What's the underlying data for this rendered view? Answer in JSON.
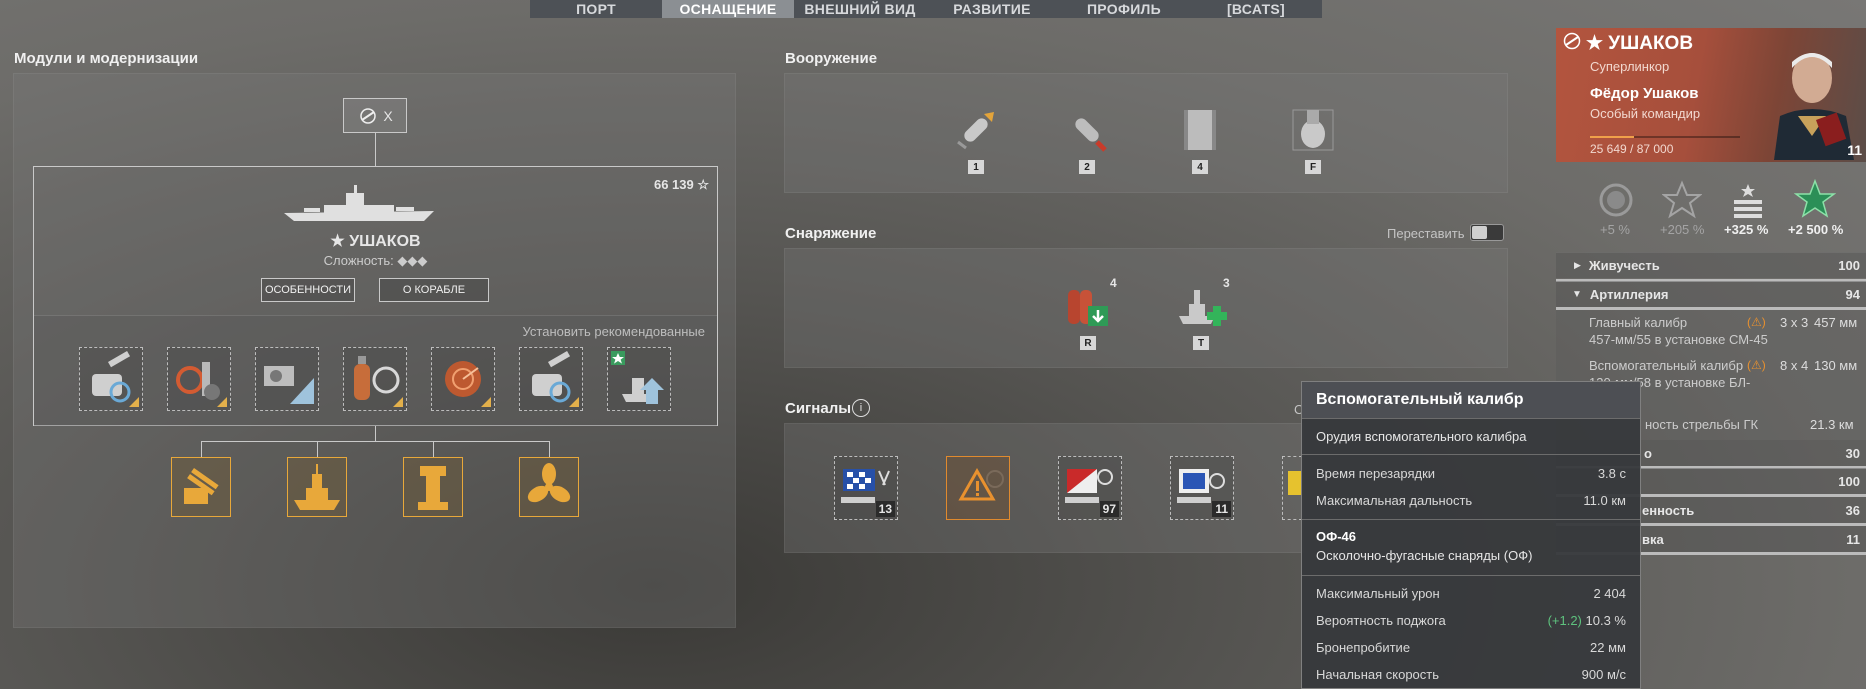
{
  "nav": {
    "tabs": [
      "ПОРТ",
      "ОСНАЩЕНИЕ",
      "ВНЕШНИЙ ВИД",
      "РАЗВИТИЕ",
      "ПРОФИЛЬ",
      "[ВСАТS]"
    ],
    "active_index": 1
  },
  "modules": {
    "title": "Модули и модернизации",
    "tier": "X",
    "ship_name": "★ УШАКОВ",
    "xp": "66 139 ☆",
    "difficulty_label": "Сложность:",
    "difficulty_marks": "◆◆◆",
    "features_button": "ОСОБЕННОСТИ",
    "about_button": "О КОРАБЛЕ",
    "install_recommended": "Установить рекомендованные",
    "upgrade_slot_icons": [
      "main-battery-mod-icon",
      "aiming-systems-mod-icon",
      "steering-gear-mod-icon",
      "damage-control-mod-icon",
      "concealment-mod-icon",
      "secondary-battery-mod-icon",
      "special-upgrade-icon"
    ],
    "module_icons": [
      "guns-module-icon",
      "hull-module-icon",
      "fire-control-module-icon",
      "propulsion-module-icon"
    ]
  },
  "armament": {
    "title": "Вооружение",
    "items": [
      {
        "icon": "shell-he-icon",
        "badge": "1"
      },
      {
        "icon": "shell-ap-icon",
        "badge": "2"
      },
      {
        "icon": "torpedo-tube-icon",
        "badge": "4"
      },
      {
        "icon": "fighter-icon",
        "badge": "F"
      }
    ]
  },
  "consumables": {
    "title": "Снаряжение",
    "rearrange_label": "Переставить",
    "items": [
      {
        "icon": "damage-control-consumable-icon",
        "count": "4",
        "key": "R"
      },
      {
        "icon": "repair-party-consumable-icon",
        "count": "3",
        "key": "T"
      }
    ]
  },
  "signals": {
    "title": "Сигналы",
    "partial_text": "С",
    "items": [
      {
        "icon": "signal-flag-blue-white-icon",
        "count": "13"
      },
      {
        "icon": "signal-warning-icon",
        "count": ""
      },
      {
        "icon": "signal-flag-red-white-icon",
        "count": "97"
      },
      {
        "icon": "signal-flag-blue-icon",
        "count": "11"
      }
    ]
  },
  "captain": {
    "ship_name": "★ УШАКОВ",
    "ship_class": "Суперлинкор",
    "commander_name": "Фёдор Ушаков",
    "commander_type": "Особый командир",
    "xp": "25 649 / 87 000",
    "xp_fraction": 0.295,
    "level": "11",
    "bonuses": [
      "+5 %",
      "+205 %",
      "+325 %",
      "+2 500 %"
    ]
  },
  "stats": {
    "survivability": {
      "label": "Живучесть",
      "value": "100"
    },
    "artillery": {
      "label": "Артиллерия",
      "value": "94"
    },
    "main_caliber_label": "Главный калибр",
    "main_caliber_config": "3 х 3",
    "main_caliber_size": "457 мм",
    "main_caliber_desc": "457-мм/55 в установке СМ-45",
    "secondary_label": "Вспомогательный калибр",
    "secondary_config": "8 х 4",
    "secondary_size": "130 мм",
    "secondary_desc": "130-мм/58 в установке БЛ-",
    "range_label": "ность стрельбы ГК",
    "range_value": "21.3 км",
    "row_a_suffix": "о",
    "row_a_value": "30",
    "row_b_value": "100",
    "row_c_suffix": "енность",
    "row_c_value": "36",
    "row_d_suffix": "вка",
    "row_d_value": "11"
  },
  "tooltip": {
    "title": "Вспомогательный калибр",
    "subtitle": "Орудия вспомогательного калибра",
    "reload_label": "Время перезарядки",
    "reload_value": "3.8 с",
    "range_label": "Максимальная дальность",
    "range_value": "11.0 км",
    "shell_name": "ОФ-46",
    "shell_type": "Осколочно-фугасные снаряды (ОФ)",
    "damage_label": "Максимальный урон",
    "damage_value": "2 404",
    "fire_label": "Вероятность поджога",
    "fire_bonus": "(+1.2)",
    "fire_value": "10.3 %",
    "pen_label": "Бронепробитие",
    "pen_value": "22 мм",
    "speed_label": "Начальная скорость",
    "speed_value": "900 м/с"
  }
}
